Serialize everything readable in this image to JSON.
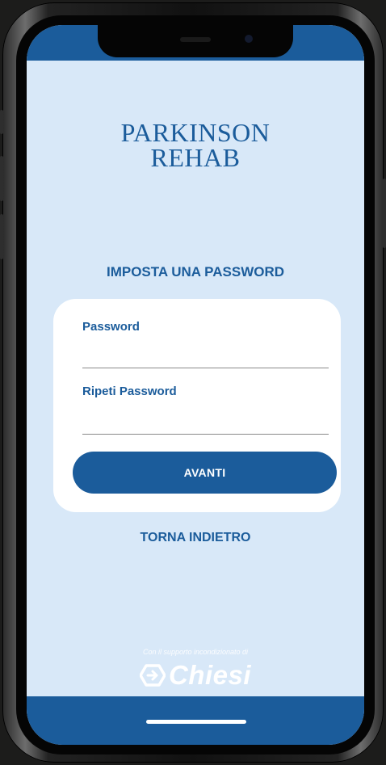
{
  "app": {
    "logo_line1": "PARKINSON",
    "logo_line2": "REHAB"
  },
  "form": {
    "title": "IMPOSTA UNA PASSWORD",
    "password_label": "Password",
    "password_value": "",
    "repeat_password_label": "Ripeti Password",
    "repeat_password_value": "",
    "submit_label": "AVANTI"
  },
  "back_link": "TORNA INDIETRO",
  "footer": {
    "sponsor_text": "Con il supporto incondizionato di",
    "sponsor_brand": "Chiesi",
    "sponsor_icon": "chiesi-logo-icon"
  },
  "colors": {
    "primary": "#1b5c9b",
    "background": "#d8e8f8",
    "card": "#ffffff",
    "device": "#1c1c1b"
  }
}
